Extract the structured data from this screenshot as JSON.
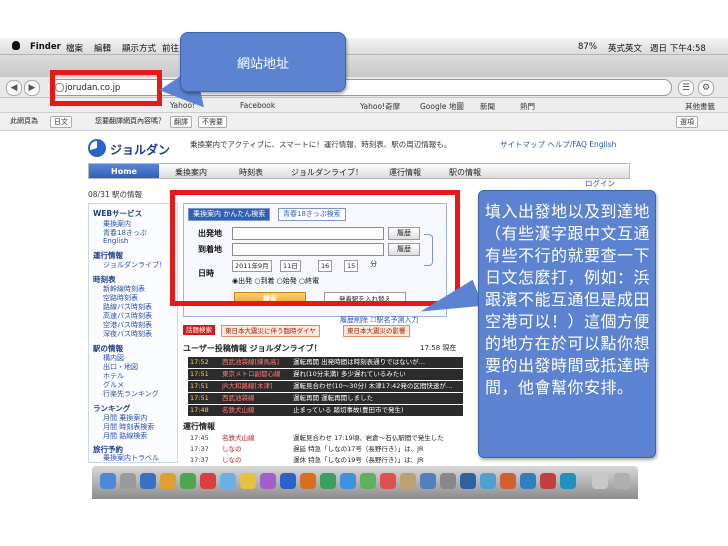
{
  "menubar": {
    "app": "Finder",
    "items": [
      "檔案",
      "編輯",
      "顯示方式",
      "前往"
    ],
    "status": [
      "87%",
      "英式英文",
      "週日 下午4:58"
    ]
  },
  "browser": {
    "url": "jorudan.co.jp",
    "bookmarks": [
      "Yahoo!",
      "Facebook",
      "Yahoo!奇摩",
      "Google 地圖",
      "新聞",
      "熱門",
      "其他書籤"
    ],
    "translate_bar": {
      "prefix": "此網頁為",
      "language": "日文",
      "question": "您要翻譯網頁內容嗎？",
      "translate": "翻譯",
      "nope": "不需要",
      "options": "選項"
    }
  },
  "page": {
    "logo": "ジョルダン",
    "tagline": "乗換案内でアクティブに、スマートに！運行情報、時刻表、駅の周辺情報も。",
    "head_links": "サイトマップ  ヘルプ/FAQ  English",
    "nav": [
      "Home",
      "乗換案内",
      "時刻表",
      "ジョルダンライブ！",
      "運行情報",
      "駅の情報"
    ],
    "subhead": "08/31 駅の情報",
    "login": "ログイン",
    "sidebar": [
      {
        "head": "WEBサービス",
        "items": [
          "乗換案内",
          "青春18きっぷ",
          "English"
        ]
      },
      {
        "head": "運行情報",
        "items": [
          "ジョルダンライブ！"
        ]
      },
      {
        "head": "時刻表",
        "items": [
          "新幹線時刻表",
          "空路時刻表",
          "路線バス時刻表",
          "高速バス時刻表",
          "空港バス時刻表",
          "深夜バス時刻表"
        ]
      },
      {
        "head": "駅の情報",
        "items": [
          "構内図",
          "出口・地図",
          "ホテル",
          "グルメ",
          "行楽先ランキング"
        ]
      },
      {
        "head": "ランキング",
        "items": [
          "月間 乗換案内",
          "月間 時刻表検索",
          "月間 路線検索"
        ]
      },
      {
        "head": "旅行予約",
        "items": [
          "乗換案内トラベル"
        ]
      }
    ],
    "search": {
      "tab_active": "乗換案内 かんたん検索",
      "tab_other": "青春18きっぷ検索",
      "from_label": "出発地",
      "to_label": "到着地",
      "time_label": "日時",
      "history_btn": "履歴",
      "year": "2011年9月",
      "day": "11日",
      "hour": "16",
      "minute": "15",
      "minute_suffix": "分",
      "options": "◉出発 ○到着 ○始発 ○終電",
      "search_btn": "検索",
      "swap_btn": "発着駅を入れ替え"
    },
    "history_links": "履歴削除  ☐駅名予測入力",
    "alert": {
      "badge": "話題検索",
      "links": [
        "東日本大震災に伴う臨時ダイヤ",
        "東日本大震災の影響"
      ]
    },
    "feed_title": "ユーザー投稿情報  ジョルダンライブ！",
    "feed_time": "17:58 現在",
    "feed": [
      {
        "time": "17:52",
        "line": "西武池袋線[練馬高]",
        "desc": "運転再開 出発時間は時刻表通りではないが…"
      },
      {
        "time": "17:51",
        "line": "東京メトロ副都心線",
        "desc": "遅れ(10分未満) 多少遅れているみたい"
      },
      {
        "time": "17:51",
        "line": "JR大和路線[木津]",
        "desc": "運転見合わせ(10〜30分) 木津17:42発の区間快速が…"
      },
      {
        "time": "17:51",
        "line": "西武池袋線",
        "desc": "運転再開 運転再開しました"
      },
      {
        "time": "17:48",
        "line": "名鉄犬山線",
        "desc": "止まっている 踏切事故(豊田市で発生)"
      }
    ],
    "ops_title": "運行情報",
    "ops": [
      {
        "time": "17:45",
        "line": "名鉄犬山線",
        "desc": "運転見合わせ 17:19頃、岩倉〜石仏駅間で発生した"
      },
      {
        "time": "17:37",
        "line": "しなの",
        "desc": "遅延 特急「しなの17号（長野行き）」は、JR"
      },
      {
        "time": "17:37",
        "line": "しなの",
        "desc": "運休 特急「しなの19号（長野行き）」は、JR"
      }
    ]
  },
  "annotations": {
    "url_callout": "網站地址",
    "form_callout": "填入出發地以及到達地（有些漢字跟中文互通有些不行的就要查一下日文怎麼打，例如：浜跟濱不能互通但是成田空港可以！）這個方便的地方在於可以點你想要的出發時間或抵達時間，他會幫你安排。"
  },
  "colors": {
    "callout": "#5b83d1",
    "highlight": "#e8171a",
    "brand": "#1d3d8c"
  }
}
